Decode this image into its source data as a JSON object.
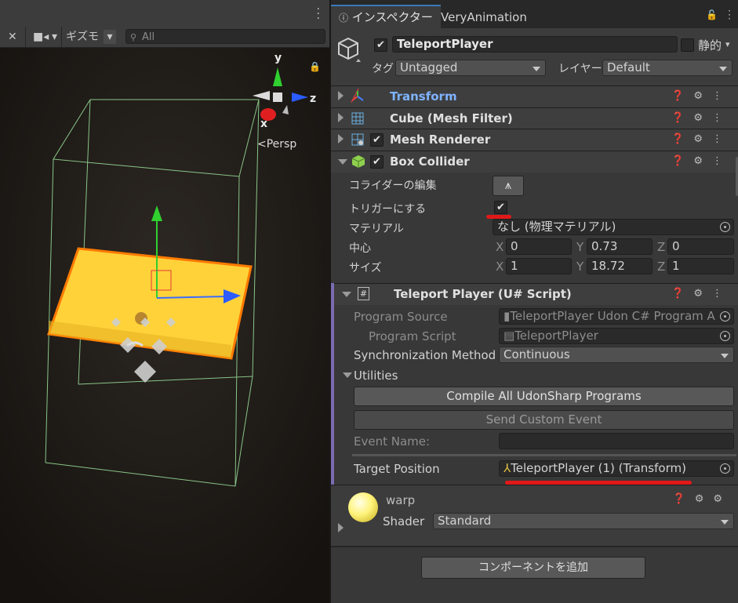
{
  "scene": {
    "toolbar": {
      "gizmos_label": "ギズモ",
      "search_placeholder": "All"
    },
    "gizmo": {
      "y_label": "y",
      "z_label": "z",
      "x_label": "x",
      "projection_label": "Persp"
    }
  },
  "inspector": {
    "tabs": [
      {
        "label": "インスペクター",
        "icon": "info-icon"
      },
      {
        "label": "VeryAnimation"
      }
    ],
    "gameobject": {
      "active": true,
      "name": "TeleportPlayer",
      "static_label": "静的",
      "tag_label": "タグ",
      "tag_value": "Untagged",
      "layer_label": "レイヤー",
      "layer_value": "Default"
    },
    "components": {
      "transform": {
        "title": "Transform"
      },
      "mesh_filter": {
        "title": "Cube (Mesh Filter)"
      },
      "mesh_renderer": {
        "title": "Mesh Renderer",
        "enabled": true
      },
      "box_collider": {
        "title": "Box Collider",
        "enabled": true,
        "edit_label": "コライダーの編集",
        "trigger_label": "トリガーにする",
        "is_trigger": true,
        "material_label": "マテリアル",
        "material_value": "なし (物理マテリアル)",
        "center_label": "中心",
        "center": {
          "x": "0",
          "y": "0.73",
          "z": "0"
        },
        "size_label": "サイズ",
        "size": {
          "x": "1",
          "y": "18.72",
          "z": "1"
        },
        "axis_x": "X",
        "axis_y": "Y",
        "axis_z": "Z"
      },
      "udon_script": {
        "title": "Teleport Player (U# Script)",
        "program_source_label": "Program Source",
        "program_source_value": "TeleportPlayer Udon C# Program A",
        "program_script_label": "Program Script",
        "program_script_value": "TeleportPlayer",
        "sync_label": "Synchronization Method",
        "sync_value": "Continuous",
        "utilities_label": "Utilities",
        "compile_button": "Compile All UdonSharp Programs",
        "send_event_button": "Send Custom Event",
        "event_name_label": "Event Name:",
        "event_name_value": "",
        "target_label": "Target Position",
        "target_value": "TeleportPlayer (1) (Transform)"
      },
      "material": {
        "name": "warp",
        "shader_label": "Shader",
        "shader_value": "Standard"
      }
    },
    "add_component_button": "コンポーネントを追加"
  },
  "colors": {
    "accent_blue": "#3a79bb",
    "transform_title": "#7fb3ff",
    "annotation_red": "#e01818",
    "udon_purple_bar": "#7b6bb0"
  }
}
